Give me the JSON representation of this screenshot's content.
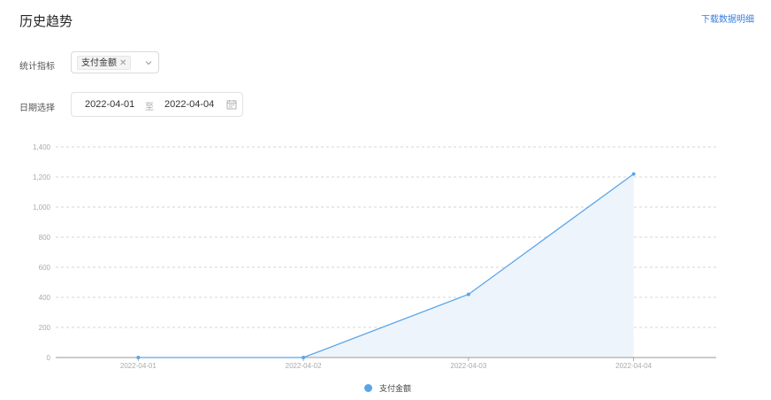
{
  "page": {
    "title": "历史趋势",
    "download_label": "下载数据明细"
  },
  "filters": {
    "metric_label": "统计指标",
    "metric_tag": "支付金额",
    "date_label": "日期选择",
    "date_start": "2022-04-01",
    "date_separator": "至",
    "date_end": "2022-04-04"
  },
  "colors": {
    "series": "#5aa5e8",
    "area": "#eef4fc",
    "grid": "#c8c8c8",
    "axis": "#999999",
    "link": "#3a7ee0"
  },
  "icons": {
    "tag_close": "close-icon",
    "dropdown": "chevron-down-icon",
    "date": "calendar-icon"
  },
  "chart_data": {
    "type": "area",
    "x": [
      "2022-04-01",
      "2022-04-02",
      "2022-04-03",
      "2022-04-04"
    ],
    "series": [
      {
        "name": "支付金额",
        "values": [
          0,
          0,
          420,
          1220
        ]
      }
    ],
    "ylim": [
      0,
      1400
    ],
    "yticks": [
      0,
      200,
      400,
      600,
      800,
      1000,
      1200,
      1400
    ],
    "ytick_labels": [
      "0",
      "200",
      "400",
      "600",
      "800",
      "1,000",
      "1,200",
      "1,400"
    ],
    "grid": true,
    "legend_position": "bottom-center"
  }
}
